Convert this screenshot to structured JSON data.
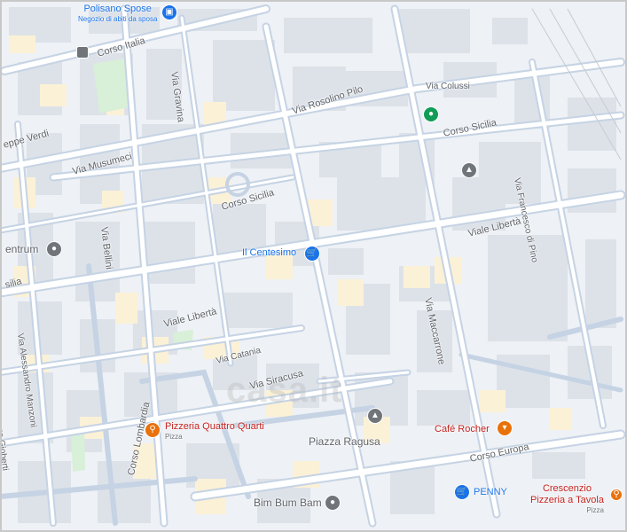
{
  "colors": {
    "background": "#eef1f5",
    "road": "#ffffff",
    "road_major": "#c5d3e4",
    "building": "#dde2e9",
    "building_highlight": "#fbf1d6",
    "park": "#d8efd8",
    "poi_blue": "#1a73e8",
    "poi_orange": "#e8710a",
    "poi_gray": "#70757a",
    "poi_green": "#0f9d58",
    "shopping_text": "#1a73e8",
    "food_text": "#c5221f"
  },
  "streets": [
    {
      "id": "corso-italia",
      "name": "Corso Italia"
    },
    {
      "id": "via-gravina",
      "name": "Via Gravina"
    },
    {
      "id": "via-rosolino-pilo",
      "name": "Via Rosolino Pilo"
    },
    {
      "id": "via-colussi",
      "name": "Via Colussi"
    },
    {
      "id": "corso-sicilia-east",
      "name": "Corso Sicilia"
    },
    {
      "id": "via-giuseppe-verdi",
      "name": "eppe Verdi"
    },
    {
      "id": "via-musumeci",
      "name": "Via Musumeci"
    },
    {
      "id": "via-francesco-di-pino",
      "name": "Via Francesco di Pino"
    },
    {
      "id": "corso-sicilia-west",
      "name": "Corso Sicilia"
    },
    {
      "id": "via-bellini",
      "name": "Via Bellini"
    },
    {
      "id": "viale-liberta-east",
      "name": "Viale Libertà"
    },
    {
      "id": "centrum",
      "name": "entrum"
    },
    {
      "id": "sicilia-edge",
      "name": "silia"
    },
    {
      "id": "via-alessandro-manzoni",
      "name": "Via Alessandro Manzoni"
    },
    {
      "id": "via-maccarrone",
      "name": "Via Maccarrone"
    },
    {
      "id": "viale-liberta-west",
      "name": "Viale Libertà"
    },
    {
      "id": "via-vincenzo-gioberti",
      "name": "Via Vincenzo Gioberti"
    },
    {
      "id": "via-catania",
      "name": "Via Catania"
    },
    {
      "id": "via-siracusa",
      "name": "Via Siracusa"
    },
    {
      "id": "piazza-ragusa",
      "name": "Piazza Ragusa"
    },
    {
      "id": "corso-europa",
      "name": "Corso Europa"
    },
    {
      "id": "corso-lombardia",
      "name": "Corso Lombardia"
    },
    {
      "id": "bim-bum-bam",
      "name": "Bim Bum Bam"
    }
  ],
  "pois": [
    {
      "id": "polisano-spose",
      "name": "Polisano Spose",
      "sub": "Negozio di abiti da sposa",
      "icon": "shopping-bag-icon",
      "color": "blue"
    },
    {
      "id": "il-centesimo",
      "name": "Il Centesimo",
      "sub": "",
      "icon": "shopping-cart-icon",
      "color": "blue"
    },
    {
      "id": "pizzeria-quattro-quarti",
      "name": "Pizzeria Quattro Quarti",
      "sub": "Pizza",
      "icon": "fork-knife-icon",
      "color": "orange"
    },
    {
      "id": "cafe-rocher",
      "name": "Café Rocher",
      "sub": "",
      "icon": "cocktail-icon",
      "color": "orange"
    },
    {
      "id": "penny",
      "name": "PENNY",
      "sub": "",
      "icon": "shopping-cart-icon",
      "color": "blue"
    },
    {
      "id": "crescenzio",
      "name": "Crescenzio Pizzeria a Tavola",
      "name_line1": "Crescenzio",
      "name_line2": "Pizzeria a Tavola",
      "sub": "Pizza",
      "icon": "fork-knife-icon",
      "color": "orange"
    }
  ],
  "watermark": "casa.it"
}
